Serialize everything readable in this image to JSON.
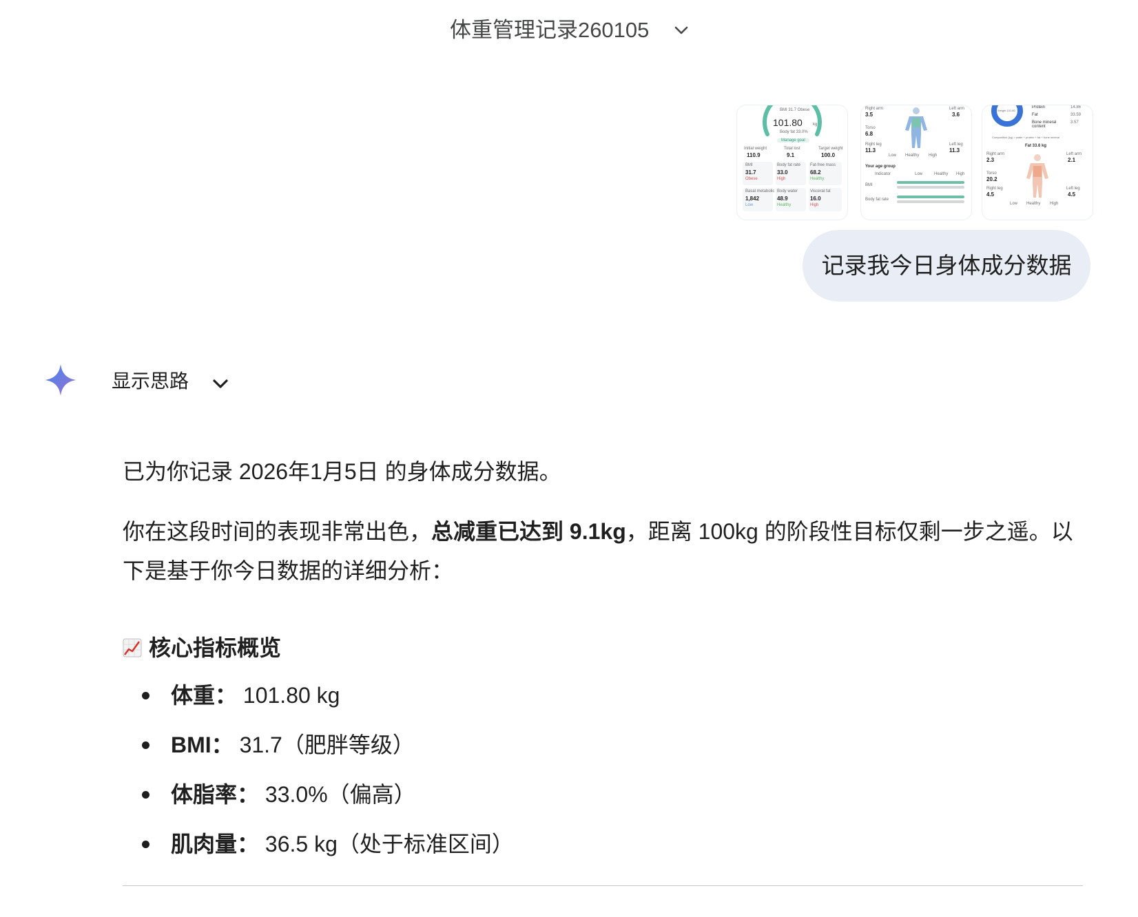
{
  "header": {
    "title": "体重管理记录260105",
    "chevron": "chevron-down-icon"
  },
  "thumbnails": {
    "t1": {
      "ring_label": "BMI 31.7 Obese",
      "weight": "101.80",
      "unit": "kg",
      "bodyfat_sub": "Body fat 33.0%",
      "manage_goal": "Manage goal",
      "initial_label": "Initial weight",
      "initial": "110.9",
      "lost_label": "Total lost",
      "lost": "9.1",
      "target_label": "Target weight",
      "target": "100.0",
      "cells": [
        {
          "label": "BMI",
          "value": "31.7",
          "status": "Obese"
        },
        {
          "label": "Body fat rate",
          "value": "33.0",
          "unit": "%",
          "status": "High"
        },
        {
          "label": "Fat-free mass",
          "value": "68.2",
          "unit": "kg",
          "status": "Healthy"
        },
        {
          "label": "Basal metabolic rate",
          "value": "1,842",
          "unit": "kcal/d",
          "status": "Low"
        },
        {
          "label": "Body water",
          "value": "48.9",
          "unit": "%",
          "status": "Healthy"
        },
        {
          "label": "Visceral fat",
          "value": "16.0",
          "unit": "Level",
          "status": "High"
        }
      ]
    },
    "t2": {
      "right_arm_label": "Right arm",
      "right_arm": "3.5",
      "left_arm_label": "Left arm",
      "left_arm": "3.6",
      "torso_label": "Torso",
      "torso": "6.8",
      "right_leg_label": "Right leg",
      "right_leg": "11.3",
      "left_leg_label": "Left leg",
      "left_leg": "11.3",
      "legend": [
        "Low",
        "Healthy",
        "High"
      ],
      "age_group": "Your age group",
      "indicator": "Indicator",
      "cols": [
        "Low",
        "Healthy",
        "High"
      ],
      "row1": "BMI",
      "row2": "Body fat rate"
    },
    "t3": {
      "donut_label": "Weight 101.80",
      "items": [
        {
          "label": "Protein",
          "value": "14.86"
        },
        {
          "label": "Fat",
          "value": "33.59"
        },
        {
          "label": "Bone mineral content",
          "value": "3.57"
        }
      ],
      "formula": "Composition (kg) = water + protein + fat + bone mineral",
      "fat_title": "Fat 33.6 kg",
      "right_arm_label": "Right arm",
      "right_arm": "2.3",
      "left_arm_label": "Left arm",
      "left_arm": "2.1",
      "torso_label": "Torso",
      "torso": "20.2",
      "right_leg_label": "Right leg",
      "right_leg": "4.5",
      "left_leg_label": "Left leg",
      "left_leg": "4.5",
      "legend": [
        "Low",
        "Healthy",
        "High"
      ]
    }
  },
  "user_message": "记录我今日身体成分数据",
  "assistant": {
    "show_thinking": "显示思路",
    "p1": "已为你记录 2026年1月5日 的身体成分数据。",
    "p2_a": "你在这段时间的表现非常出色，",
    "p2_bold": "总减重已达到 9.1kg",
    "p2_b": "，距离 100kg 的阶段性目标仅剩一步之遥。以下是基于你今日数据的详细分析：",
    "section_title": "核心指标概览",
    "section_icon": "chart-increasing-icon",
    "items": [
      {
        "label": "体重：",
        "value": "101.80 kg"
      },
      {
        "label": "BMI：",
        "value": "31.7（肥胖等级）"
      },
      {
        "label": "体脂率：",
        "value": "33.0%（偏高）"
      },
      {
        "label": "肌肉量：",
        "value": "36.5 kg（处于标准区间）"
      }
    ]
  },
  "colors": {
    "bubble": "#e9eef6",
    "spark_start": "#4285f4",
    "spark_end": "#9b72cb",
    "ring": "#5cbfa5"
  }
}
